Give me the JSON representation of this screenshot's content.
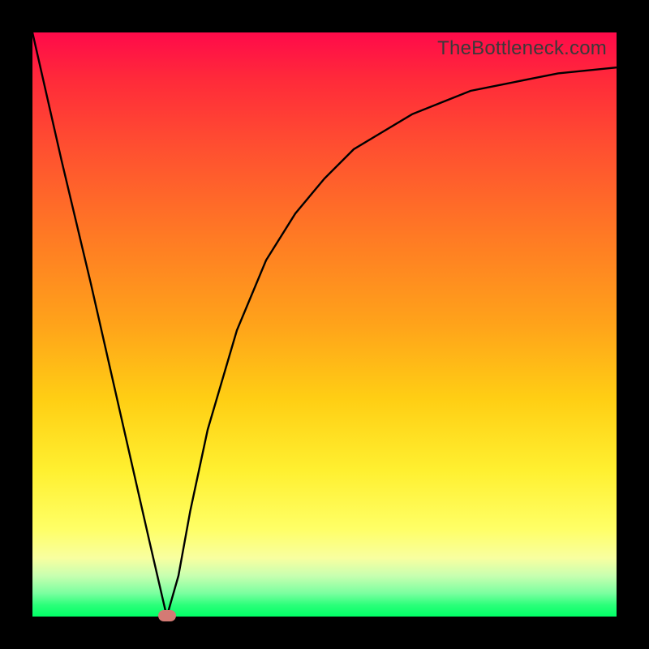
{
  "watermark": "TheBottleneck.com",
  "colors": {
    "frame_background": "#000000",
    "curve_stroke": "#000000",
    "marker_fill": "#d47a74",
    "gradient_top": "#ff0a4a",
    "gradient_bottom": "#00ff66"
  },
  "chart_data": {
    "type": "line",
    "title": "",
    "xlabel": "",
    "ylabel": "",
    "xlim": [
      0,
      100
    ],
    "ylim": [
      0,
      100
    ],
    "grid": false,
    "legend": false,
    "series": [
      {
        "name": "bottleneck-curve",
        "x": [
          0,
          5,
          10,
          15,
          20,
          23,
          25,
          27,
          30,
          35,
          40,
          45,
          50,
          55,
          60,
          65,
          70,
          75,
          80,
          85,
          90,
          95,
          100
        ],
        "y": [
          100,
          78,
          57,
          35,
          13,
          0,
          7,
          18,
          32,
          49,
          61,
          69,
          75,
          80,
          83,
          86,
          88,
          90,
          91,
          92,
          93,
          93.5,
          94
        ]
      }
    ],
    "annotations": [
      {
        "name": "optimal-marker",
        "type": "marker",
        "x": 23,
        "y": 0,
        "color": "#d47a74"
      }
    ],
    "background_gradient": {
      "direction": "vertical",
      "stops": [
        {
          "pos": 0.0,
          "color": "#ff0a4a"
        },
        {
          "pos": 0.08,
          "color": "#ff2a3a"
        },
        {
          "pos": 0.2,
          "color": "#ff5030"
        },
        {
          "pos": 0.35,
          "color": "#ff7a24"
        },
        {
          "pos": 0.5,
          "color": "#ffa31a"
        },
        {
          "pos": 0.63,
          "color": "#ffcf14"
        },
        {
          "pos": 0.75,
          "color": "#fff030"
        },
        {
          "pos": 0.85,
          "color": "#ffff66"
        },
        {
          "pos": 0.9,
          "color": "#f8ffa0"
        },
        {
          "pos": 0.93,
          "color": "#c8ffb0"
        },
        {
          "pos": 0.96,
          "color": "#7bffa0"
        },
        {
          "pos": 0.98,
          "color": "#2cff7a"
        },
        {
          "pos": 1.0,
          "color": "#00ff66"
        }
      ]
    }
  }
}
